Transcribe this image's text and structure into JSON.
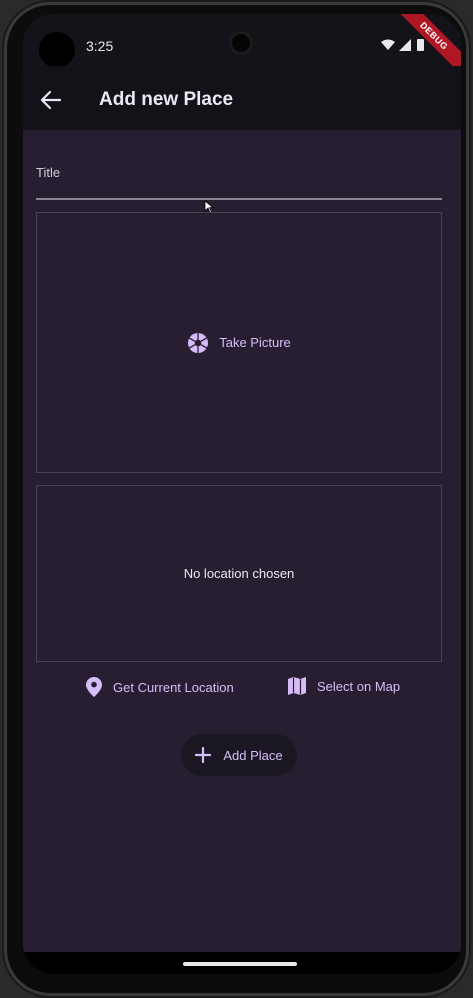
{
  "status_bar": {
    "time": "3:25",
    "debug_banner": "DEBUG"
  },
  "app_bar": {
    "title": "Add new Place",
    "back_icon": "arrow-left-icon"
  },
  "form": {
    "title_label": "Title",
    "title_value": "",
    "picture": {
      "label": "Take Picture",
      "icon": "camera-shutter-icon"
    },
    "location": {
      "status": "No location chosen",
      "get_current_label": "Get Current Location",
      "get_current_icon": "location-pin-icon",
      "select_on_map_label": "Select on Map",
      "select_on_map_icon": "map-icon"
    },
    "submit": {
      "label": "Add Place",
      "icon": "plus-icon"
    }
  },
  "colors": {
    "accent": "#d6bdfa",
    "background": "#271f31",
    "appbar": "#141219",
    "debug": "#b01725"
  }
}
